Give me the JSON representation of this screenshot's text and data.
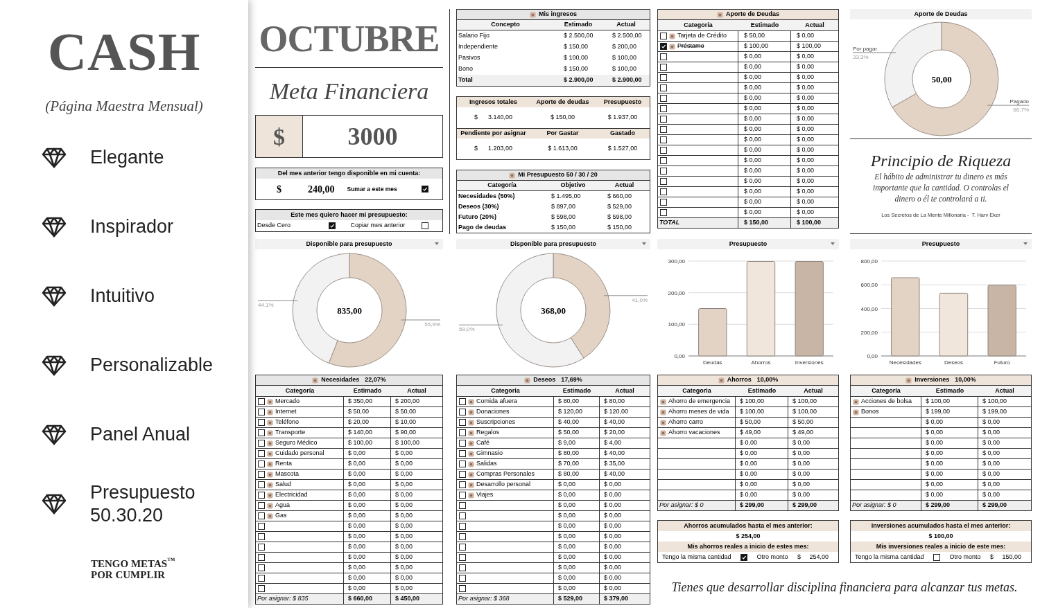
{
  "promo": {
    "title": "CASH",
    "subtitle": "(Página Maestra Mensual)",
    "features": [
      "Elegante",
      "Inspirador",
      "Intuitivo",
      "Personalizable",
      "Panel Anual",
      "Presupuesto 50.30.20"
    ],
    "brand": [
      "TENGO METAS$^{™}$",
      "POR CUMPLIR"
    ]
  },
  "month": {
    "name": "OCTUBRE",
    "goal_title": "Meta Financiera",
    "goal_currency": "$",
    "goal_amount": "3000"
  },
  "carryover": {
    "title": "Del mes anterior tengo disponible en mi cuenta:",
    "currency": "$",
    "amount": "240,00",
    "option": "Sumar a este mes",
    "checked": true
  },
  "budget_mode": {
    "title": "Este mes quiero hacer mi presupuesto:",
    "options": [
      {
        "label": "Desde Cero",
        "checked": true
      },
      {
        "label": "Copiar mes anterior",
        "checked": false
      }
    ]
  },
  "income": {
    "title": "Mis ingresos",
    "columns": [
      "Concepto",
      "Estimado",
      "Actual"
    ],
    "rows": [
      [
        "Salario Fijo",
        "$ 2.500,00",
        "$ 2.500,00"
      ],
      [
        "Independiente",
        "$ 150,00",
        "$ 200,00"
      ],
      [
        "Pasivos",
        "$ 100,00",
        "$ 100,00"
      ],
      [
        "Bono",
        "$ 150,00",
        "$ 100,00"
      ]
    ],
    "total": [
      "Total",
      "$ 2.900,00",
      "$ 2.900,00"
    ]
  },
  "summary": [
    {
      "labels": [
        "Ingresos totales",
        "Aporte de deudas",
        "Presupuesto"
      ],
      "values": [
        "$      3.140,00",
        "$ 150,00",
        "$ 1.937,00"
      ]
    },
    {
      "labels": [
        "Pendiente por asignar",
        "Por Gastar",
        "Gastado"
      ],
      "values": [
        "$      1.203,00",
        "$ 1.613,00",
        "$ 1.527,00"
      ]
    }
  ],
  "plan": {
    "title": "Mi Presupuesto 50 / 30 / 20",
    "columns": [
      "Categoría",
      "Objetivo",
      "Actual"
    ],
    "rows": [
      [
        "Necesidades (50%)",
        "$ 1.495,00",
        "$ 660,00"
      ],
      [
        "Deseos (30%)",
        "$ 897,00",
        "$ 529,00"
      ],
      [
        "Futuro (20%)",
        "$ 598,00",
        "$ 598,00"
      ],
      [
        "Pago de deudas",
        "$ 150,00",
        "$ 150,00"
      ]
    ]
  },
  "debts": {
    "title": "Aporte de Deudas",
    "columns": [
      "Categoría",
      "Estimado",
      "Actual"
    ],
    "rows": [
      {
        "checked": false,
        "label": "Tarjeta de Crédito",
        "estimated": "$ 50,00",
        "actual": "$ 0,00"
      },
      {
        "checked": true,
        "label": "Préstamo",
        "estimated": "$ 100,00",
        "actual": "$ 100,00"
      },
      {
        "checked": false,
        "estimated": "$ 0,00",
        "actual": "$ 0,00"
      },
      {
        "checked": false,
        "estimated": "$ 0,00",
        "actual": "$ 0,00"
      },
      {
        "checked": false,
        "estimated": "$ 0,00",
        "actual": "$ 0,00"
      },
      {
        "checked": false,
        "estimated": "$ 0,00",
        "actual": "$ 0,00"
      },
      {
        "checked": false,
        "estimated": "$ 0,00",
        "actual": "$ 0,00"
      },
      {
        "checked": false,
        "estimated": "$ 0,00",
        "actual": "$ 0,00"
      },
      {
        "checked": false,
        "estimated": "$ 0,00",
        "actual": "$ 0,00"
      },
      {
        "checked": false,
        "estimated": "$ 0,00",
        "actual": "$ 0,00"
      },
      {
        "checked": false,
        "estimated": "$ 0,00",
        "actual": "$ 0,00"
      },
      {
        "checked": false,
        "estimated": "$ 0,00",
        "actual": "$ 0,00"
      },
      {
        "checked": false,
        "estimated": "$ 0,00",
        "actual": "$ 0,00"
      },
      {
        "checked": false,
        "estimated": "$ 0,00",
        "actual": "$ 0,00"
      },
      {
        "checked": false,
        "estimated": "$ 0,00",
        "actual": "$ 0,00"
      },
      {
        "checked": false,
        "estimated": "$ 0,00",
        "actual": "$ 0,00"
      },
      {
        "checked": false,
        "estimated": "$ 0,00",
        "actual": "$ 0,00"
      },
      {
        "checked": false,
        "estimated": "$ 0,00",
        "actual": "$ 0,00"
      }
    ],
    "total": [
      "TOTAL",
      "$ 150,00",
      "$ 100,00"
    ]
  },
  "debt_chart": {
    "title": "Aporte de Deudas",
    "center": "50,00",
    "chart_data": {
      "type": "donut",
      "categories": [
        "Pagado",
        "Por pagar"
      ],
      "values": [
        66.7,
        33.3
      ],
      "value_labels": [
        "66,7%",
        "33,3%"
      ]
    }
  },
  "wealth_quote": {
    "title": "Principio de Riqueza",
    "text": "El hábito de administrar tu dinero es más importante que la cantidad. O controlas el dinero o él te controlará a ti.",
    "source": "Los Secretos de La Mente Millonaria -  T. Harv Eker"
  },
  "charts": [
    {
      "title": "Disponible para presupuesto",
      "center": "835,00",
      "chart_data": {
        "type": "donut",
        "values": [
          55.9,
          44.1
        ],
        "value_labels": [
          "55,9%",
          "44,1%"
        ]
      }
    },
    {
      "title": "Disponible para presupuesto",
      "center": "368,00",
      "chart_data": {
        "type": "donut",
        "values": [
          41.0,
          59.0
        ],
        "value_labels": [
          "41,0%",
          "59,0%"
        ]
      }
    },
    {
      "title": "Presupuesto",
      "chart_data": {
        "type": "bar",
        "categories": [
          "Deudas",
          "Ahorros",
          "Inversiones"
        ],
        "values": [
          150,
          299,
          299
        ],
        "grid": true,
        "ylim": [
          0,
          300
        ],
        "yticks": [
          {
            "value": 0,
            "label": "0,00"
          },
          {
            "value": 100,
            "label": "100,00"
          },
          {
            "value": 200,
            "label": "200,00"
          },
          {
            "value": 300,
            "label": "300,00"
          }
        ]
      }
    },
    {
      "title": "Presupuesto",
      "chart_data": {
        "type": "bar",
        "categories": [
          "Necesidades",
          "Deseos",
          "Futuro"
        ],
        "values": [
          660,
          529,
          598
        ],
        "grid": true,
        "ylim": [
          0,
          800
        ],
        "yticks": [
          {
            "value": 0,
            "label": "0,00"
          },
          {
            "value": 200,
            "label": "200,00"
          },
          {
            "value": 400,
            "label": "400,00"
          },
          {
            "value": 600,
            "label": "600,00"
          },
          {
            "value": 800,
            "label": "800,00"
          }
        ]
      }
    }
  ],
  "tables": [
    {
      "title": "Necesidades",
      "percent": "22,07%",
      "kind": "checklist",
      "columns": [
        "Categoría",
        "Estimado",
        "Actual"
      ],
      "rows": [
        {
          "checked": false,
          "label": "Mercado",
          "estimated": "$ 350,00",
          "actual": "$ 200,00"
        },
        {
          "checked": false,
          "label": "Internet",
          "estimated": "$ 50,00",
          "actual": "$ 50,00"
        },
        {
          "checked": false,
          "label": "Teléfono",
          "estimated": "$ 20,00",
          "actual": "$ 10,00"
        },
        {
          "checked": false,
          "label": "Transporte",
          "estimated": "$ 140,00",
          "actual": "$ 90,00"
        },
        {
          "checked": false,
          "label": "Seguro Médico",
          "estimated": "$ 100,00",
          "actual": "$ 100,00"
        },
        {
          "checked": false,
          "label": "Cuidado personal",
          "estimated": "$ 0,00",
          "actual": "$ 0,00"
        },
        {
          "checked": false,
          "label": "Renta",
          "estimated": "$ 0,00",
          "actual": "$ 0,00"
        },
        {
          "checked": false,
          "label": "Mascota",
          "estimated": "$ 0,00",
          "actual": "$ 0,00"
        },
        {
          "checked": false,
          "label": "Salud",
          "estimated": "$ 0,00",
          "actual": "$ 0,00"
        },
        {
          "checked": false,
          "label": "Electricidad",
          "estimated": "$ 0,00",
          "actual": "$ 0,00"
        },
        {
          "checked": false,
          "label": "Agua",
          "estimated": "$ 0,00",
          "actual": "$ 0,00"
        },
        {
          "checked": false,
          "label": "Gas",
          "estimated": "$ 0,00",
          "actual": "$ 0,00"
        },
        {
          "checked": false,
          "estimated": "$ 0,00",
          "actual": "$ 0,00"
        },
        {
          "checked": false,
          "estimated": "$ 0,00",
          "actual": "$ 0,00"
        },
        {
          "checked": false,
          "estimated": "$ 0,00",
          "actual": "$ 0,00"
        },
        {
          "checked": false,
          "estimated": "$ 0,00",
          "actual": "$ 0,00"
        },
        {
          "checked": false,
          "estimated": "$ 0,00",
          "actual": "$ 0,00"
        },
        {
          "checked": false,
          "estimated": "$ 0,00",
          "actual": "$ 0,00"
        },
        {
          "checked": false,
          "estimated": "$ 0,00",
          "actual": "$ 0,00"
        }
      ],
      "footer": [
        "Por asignar: $ 835",
        "$ 660,00",
        "$ 450,00"
      ]
    },
    {
      "title": "Deseos",
      "percent": "17,69%",
      "kind": "checklist",
      "columns": [
        "Categoria",
        "Estimado",
        "Actual"
      ],
      "rows": [
        {
          "checked": false,
          "label": "Comida afuera",
          "estimated": "$ 80,00",
          "actual": "$ 80,00"
        },
        {
          "checked": false,
          "label": "Donaciones",
          "estimated": "$ 120,00",
          "actual": "$ 120,00"
        },
        {
          "checked": false,
          "label": "Suscripciones",
          "estimated": "$ 40,00",
          "actual": "$ 40,00"
        },
        {
          "checked": false,
          "label": "Regalos",
          "estimated": "$ 50,00",
          "actual": "$ 20,00"
        },
        {
          "checked": false,
          "label": "Café",
          "estimated": "$ 9,00",
          "actual": "$ 4,00"
        },
        {
          "checked": false,
          "label": "Gimnasio",
          "estimated": "$ 80,00",
          "actual": "$ 40,00"
        },
        {
          "checked": false,
          "label": "Salidas",
          "estimated": "$ 70,00",
          "actual": "$ 35,00"
        },
        {
          "checked": false,
          "label": "Compras Personales",
          "estimated": "$ 80,00",
          "actual": "$ 40,00"
        },
        {
          "checked": false,
          "label": "Desarrollo personal",
          "estimated": "$ 0,00",
          "actual": "$ 0,00"
        },
        {
          "checked": false,
          "label": "Viajes",
          "estimated": "$ 0,00",
          "actual": "$ 0,00"
        },
        {
          "checked": false,
          "estimated": "$ 0,00",
          "actual": "$ 0,00"
        },
        {
          "checked": false,
          "estimated": "$ 0,00",
          "actual": "$ 0,00"
        },
        {
          "checked": false,
          "estimated": "$ 0,00",
          "actual": "$ 0,00"
        },
        {
          "checked": false,
          "estimated": "$ 0,00",
          "actual": "$ 0,00"
        },
        {
          "checked": false,
          "estimated": "$ 0,00",
          "actual": "$ 0,00"
        },
        {
          "checked": false,
          "estimated": "$ 0,00",
          "actual": "$ 0,00"
        },
        {
          "checked": false,
          "estimated": "$ 0,00",
          "actual": "$ 0,00"
        },
        {
          "checked": false,
          "estimated": "$ 0,00",
          "actual": "$ 0,00"
        },
        {
          "checked": false,
          "estimated": "$ 0,00",
          "actual": "$ 0,00"
        }
      ],
      "footer": [
        "Por asignar: $ 368",
        "$ 529,00",
        "$ 379,00"
      ]
    },
    {
      "title": "Ahorros",
      "percent": "10,00%",
      "kind": "plain",
      "columns": [
        "Categoria",
        "Estimado",
        "Actual"
      ],
      "rows": [
        {
          "label": "Ahorro de emergencia",
          "estimated": "$ 100,00",
          "actual": "$ 100,00"
        },
        {
          "label": "Ahorro meses de vida",
          "estimated": "$ 100,00",
          "actual": "$ 100,00"
        },
        {
          "label": "Ahorro carro",
          "estimated": "$ 50,00",
          "actual": "$ 50,00"
        },
        {
          "label": "Ahorro vacaciones",
          "estimated": "$ 49,00",
          "actual": "$ 49,00"
        },
        {
          "estimated": "$ 0,00",
          "actual": "$ 0,00"
        },
        {
          "estimated": "$ 0,00",
          "actual": "$ 0,00"
        },
        {
          "estimated": "$ 0,00",
          "actual": "$ 0,00"
        },
        {
          "estimated": "$ 0,00",
          "actual": "$ 0,00"
        },
        {
          "estimated": "$ 0,00",
          "actual": "$ 0,00"
        },
        {
          "estimated": "$ 0,00",
          "actual": "$ 0,00"
        }
      ],
      "footer": [
        "Por asignar: $ 0",
        "$ 299,00",
        "$ 299,00"
      ]
    },
    {
      "title": "Inversiones",
      "percent": "10,00%",
      "kind": "plain",
      "columns": [
        "Categoría",
        "Estimado",
        "Actual"
      ],
      "rows": [
        {
          "label": "Acciones de bolsa",
          "estimated": "$ 100,00",
          "actual": "$ 100,00"
        },
        {
          "label": "Bonos",
          "estimated": "$ 199,00",
          "actual": "$ 199,00"
        },
        {
          "estimated": "$ 0,00",
          "actual": "$ 0,00"
        },
        {
          "estimated": "$ 0,00",
          "actual": "$ 0,00"
        },
        {
          "estimated": "$ 0,00",
          "actual": "$ 0,00"
        },
        {
          "estimated": "$ 0,00",
          "actual": "$ 0,00"
        },
        {
          "estimated": "$ 0,00",
          "actual": "$ 0,00"
        },
        {
          "estimated": "$ 0,00",
          "actual": "$ 0,00"
        },
        {
          "estimated": "$ 0,00",
          "actual": "$ 0,00"
        },
        {
          "estimated": "$ 0,00",
          "actual": "$ 0,00"
        }
      ],
      "footer": [
        "Por asignar: $ 0",
        "$ 299,00",
        "$ 299,00"
      ]
    }
  ],
  "accumulated": [
    {
      "title": "Ahorros acumulados hasta el mes anterior:",
      "amount": "$ 254,00",
      "subtitle": "Mis ahorros reales a inicio de estes mes:",
      "same_label": "Tengo la misma cantidad",
      "checked": true,
      "other_label": "Otro monto",
      "other_amount": "$     254,00"
    },
    {
      "title": "Inversiones acumulados hasta el mes anterior:",
      "amount": "$ 100,00",
      "subtitle": "Mis inversiones reales a inicio de este mes:",
      "same_label": "Tengo la misma cantidad",
      "checked": false,
      "other_label": "Otro monto",
      "other_amount": "$     150,00"
    }
  ],
  "closing": "Tienes que desarrollar disciplina financiera para alcanzar tus metas."
}
